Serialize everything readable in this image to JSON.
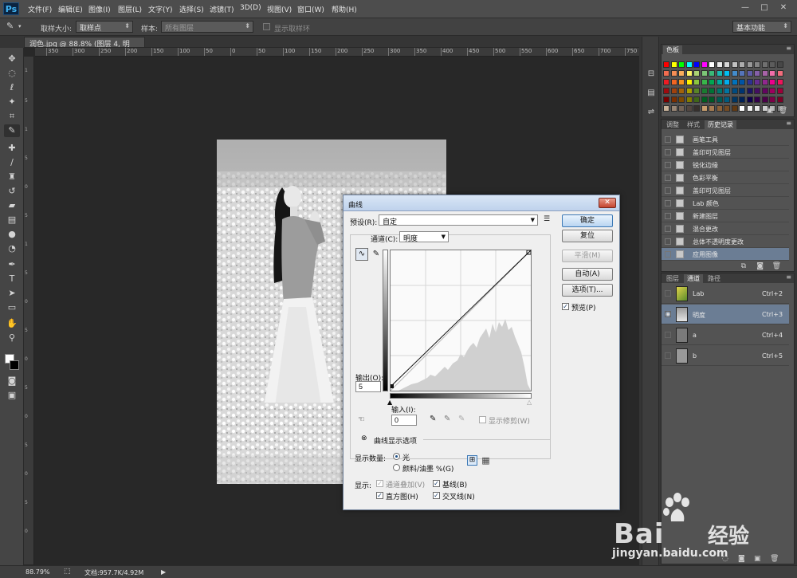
{
  "app": {
    "logo": "Ps"
  },
  "menu": [
    "文件(F)",
    "编辑(E)",
    "图像(I)",
    "图层(L)",
    "文字(Y)",
    "选择(S)",
    "滤镜(T)",
    "3D(D)",
    "视图(V)",
    "窗口(W)",
    "帮助(H)"
  ],
  "window_controls": {
    "minimize": "—",
    "restore": "□",
    "close": "✕"
  },
  "options": {
    "sample_size_label": "取样大小:",
    "sample_size_value": "取样点",
    "sample_label": "样本:",
    "sample_value": "所有图层",
    "show_ring_label": "显示取样环",
    "workspace": "基本功能"
  },
  "doc": {
    "tab_title": "润色.jpg @ 88.8% (图层 4, 明度/8) *",
    "close": "×"
  },
  "ruler": {
    "h_ticks": [
      "350",
      "300",
      "250",
      "200",
      "150",
      "100",
      "50",
      "0",
      "50",
      "100",
      "150",
      "200",
      "250",
      "300",
      "350",
      "400",
      "450",
      "500",
      "550",
      "600",
      "650",
      "700",
      "750"
    ]
  },
  "status": {
    "zoom": "88.79%",
    "doc_label": "文档:957.7K/4.92M"
  },
  "panels": {
    "swatches": {
      "tab": "色板"
    },
    "history": {
      "tabs": [
        "调整",
        "样式",
        "历史记录"
      ],
      "items": [
        "画笔工具",
        "盖印可见图层",
        "锐化边缘",
        "色彩平衡",
        "盖印可见图层",
        "Lab 颜色",
        "新建图层",
        "混合更改",
        "总体不透明度更改",
        "应用图像"
      ]
    },
    "channels": {
      "tabs": [
        "图层",
        "通道",
        "路径"
      ],
      "items": [
        {
          "name": "Lab",
          "key": "Ctrl+2"
        },
        {
          "name": "明度",
          "key": "Ctrl+3"
        },
        {
          "name": "a",
          "key": "Ctrl+4"
        },
        {
          "name": "b",
          "key": "Ctrl+5"
        }
      ]
    }
  },
  "curves": {
    "title": "曲线",
    "preset_label": "预设(R):",
    "preset_value": "自定",
    "channel_label": "通道(C):",
    "channel_value": "明度",
    "output_label": "输出(O):",
    "output_value": "5",
    "input_label": "输入(I):",
    "input_value": "0",
    "show_clipping": "显示修剪(W)",
    "display_options": "曲线显示选项",
    "show_amount_label": "显示数量:",
    "light_option": "光",
    "pigment_option": "颜料/油墨 %(G)",
    "show_label": "显示:",
    "channel_overlays": "通道叠加(V)",
    "baseline": "基线(B)",
    "histogram": "直方图(H)",
    "intersection": "交叉线(N)",
    "buttons": {
      "ok": "确定",
      "reset": "复位",
      "smooth": "平滑(M)",
      "auto": "自动(A)",
      "options": "选项(T)..."
    },
    "preview": "预览(P)"
  },
  "watermark": {
    "brand": "Bai",
    "brand_cn": "经验",
    "url": "jingyan.baidu.com"
  }
}
